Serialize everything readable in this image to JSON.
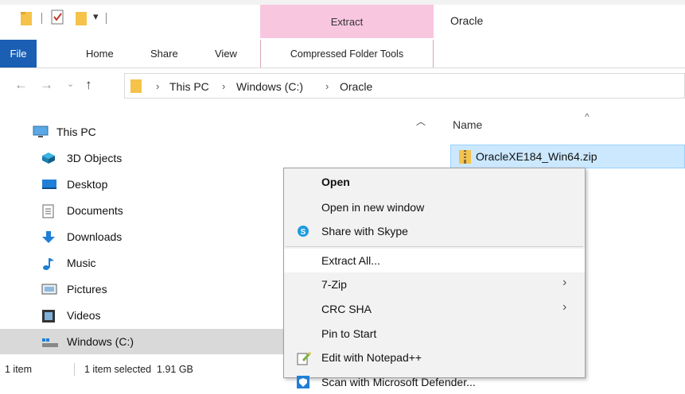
{
  "window": {
    "title": "Oracle",
    "contextual_header": "Extract"
  },
  "ribbon": {
    "tabs": [
      "File",
      "Home",
      "Share",
      "View"
    ],
    "contextual_tab": "Compressed Folder Tools"
  },
  "address": {
    "crumbs": [
      "This PC",
      "Windows (C:)",
      "Oracle"
    ],
    "separator": "›"
  },
  "nav_pane": {
    "items": [
      {
        "label": "This PC",
        "icon": "this-pc-icon"
      },
      {
        "label": "3D Objects",
        "icon": "3d-objects-icon"
      },
      {
        "label": "Desktop",
        "icon": "desktop-icon"
      },
      {
        "label": "Documents",
        "icon": "documents-icon"
      },
      {
        "label": "Downloads",
        "icon": "downloads-icon"
      },
      {
        "label": "Music",
        "icon": "music-icon"
      },
      {
        "label": "Pictures",
        "icon": "pictures-icon"
      },
      {
        "label": "Videos",
        "icon": "videos-icon"
      },
      {
        "label": "Windows (C:)",
        "icon": "drive-icon"
      }
    ],
    "selected": "Windows (C:)"
  },
  "file_list": {
    "column_name": "Name",
    "files": [
      {
        "name": "OracleXE184_Win64.zip",
        "icon": "zip-folder-icon",
        "selected": true
      }
    ]
  },
  "status_bar": {
    "item_count": "1 item",
    "selection": "1 item selected  1.91 GB"
  },
  "context_menu": {
    "items": [
      {
        "label": "Open",
        "bold": true
      },
      {
        "label": "Open in new window"
      },
      {
        "label": "Share with Skype",
        "icon": "skype-icon"
      },
      {
        "label": "Extract All...",
        "hover": true
      },
      {
        "label": "7-Zip",
        "submenu": true
      },
      {
        "label": "CRC SHA",
        "submenu": true
      },
      {
        "label": "Pin to Start"
      },
      {
        "label": "Edit with Notepad++",
        "icon": "notepad-plus-icon"
      },
      {
        "label": "Scan with Microsoft Defender...",
        "icon": "defender-icon"
      }
    ]
  },
  "colors": {
    "accent": "#1a5fb4",
    "contextual_tab": "#f9c6df",
    "selection": "#cce8ff"
  }
}
